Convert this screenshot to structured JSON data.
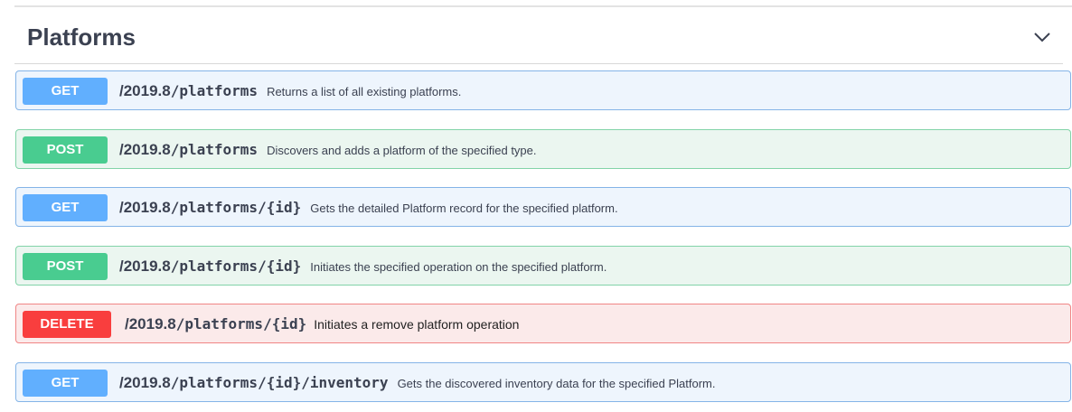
{
  "section": {
    "title": "Platforms",
    "collapse_icon": "chevron-down-icon"
  },
  "colors": {
    "get": "#61affe",
    "post": "#49cc90",
    "delete": "#f93e3e"
  },
  "operations": [
    {
      "method": "GET",
      "version": "/2019.8",
      "path": "/platforms",
      "description": "Returns a list of all existing platforms."
    },
    {
      "method": "POST",
      "version": "/2019.8",
      "path": "/platforms",
      "description": "Discovers and adds a platform of the specified type."
    },
    {
      "method": "GET",
      "version": "/2019.8",
      "path": "/platforms/{id}",
      "description": "Gets the detailed Platform record for the specified platform."
    },
    {
      "method": "POST",
      "version": "/2019.8",
      "path": "/platforms/{id}",
      "description": "Initiates the specified operation on the specified platform."
    },
    {
      "method": "DELETE",
      "version": "/2019.8",
      "path": "/platforms/{id}",
      "description": "Initiates a remove platform operation"
    },
    {
      "method": "GET",
      "version": "/2019.8",
      "path": "/platforms/{id}/inventory",
      "description": "Gets the discovered inventory data for the specified Platform."
    }
  ]
}
